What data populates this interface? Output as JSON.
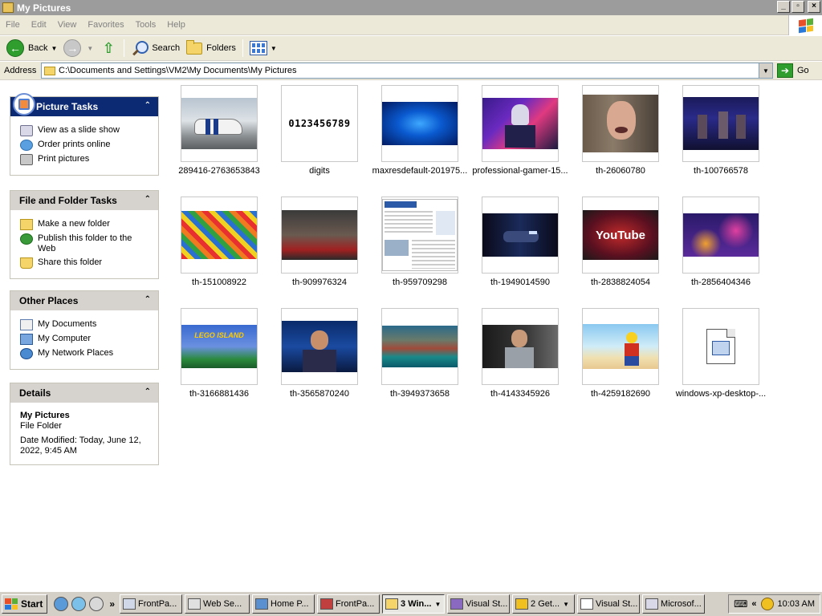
{
  "window": {
    "title": "My Pictures"
  },
  "menu": [
    "File",
    "Edit",
    "View",
    "Favorites",
    "Tools",
    "Help"
  ],
  "toolbar": {
    "back": "Back",
    "search": "Search",
    "folders": "Folders"
  },
  "address": {
    "label": "Address",
    "path": "C:\\Documents and Settings\\VM2\\My Documents\\My Pictures",
    "go": "Go"
  },
  "panels": {
    "picture_tasks": {
      "title": "Picture Tasks",
      "items": [
        "View as a slide show",
        "Order prints online",
        "Print pictures"
      ]
    },
    "file_folder_tasks": {
      "title": "File and Folder Tasks",
      "items": [
        "Make a new folder",
        "Publish this folder to the Web",
        "Share this folder"
      ]
    },
    "other_places": {
      "title": "Other Places",
      "items": [
        "My Documents",
        "My Computer",
        "My Network Places"
      ]
    },
    "details": {
      "title": "Details",
      "name": "My Pictures",
      "type": "File Folder",
      "modified": "Date Modified: Today, June 12, 2022, 9:45 AM"
    }
  },
  "files": [
    {
      "name": "289416-2763653843",
      "thumb": "car"
    },
    {
      "name": "digits",
      "thumb": "digits",
      "text": "0123456789"
    },
    {
      "name": "maxresdefault-201975...",
      "thumb": "blue-particles"
    },
    {
      "name": "professional-gamer-15...",
      "thumb": "gamer-stage"
    },
    {
      "name": "th-26060780",
      "thumb": "face"
    },
    {
      "name": "th-100766578",
      "thumb": "band"
    },
    {
      "name": "th-151008922",
      "thumb": "lego-bricks"
    },
    {
      "name": "th-909976324",
      "thumb": "gaming-cafe"
    },
    {
      "name": "th-959709298",
      "thumb": "webpage"
    },
    {
      "name": "th-1949014590",
      "thumb": "dark-car"
    },
    {
      "name": "th-2838824054",
      "thumb": "youtube",
      "text": "YouTube"
    },
    {
      "name": "th-2856404346",
      "thumb": "purple-bokeh"
    },
    {
      "name": "th-3166881436",
      "thumb": "lego-island",
      "text": "LEGO ISLAND"
    },
    {
      "name": "th-3565870240",
      "thumb": "streamer"
    },
    {
      "name": "th-3949373658",
      "thumb": "lake"
    },
    {
      "name": "th-4143345926",
      "thumb": "headset-guy"
    },
    {
      "name": "th-4259182690",
      "thumb": "lego-figure"
    },
    {
      "name": "windows-xp-desktop-...",
      "thumb": "document-icon"
    }
  ],
  "taskbar": {
    "start": "Start",
    "tasks": [
      {
        "label": "FrontPa...",
        "active": false,
        "dd": false
      },
      {
        "label": "Web Se...",
        "active": false,
        "dd": false
      },
      {
        "label": "Home P...",
        "active": false,
        "dd": false
      },
      {
        "label": "FrontPa...",
        "active": false,
        "dd": false
      },
      {
        "label": "3 Win...",
        "active": true,
        "dd": true
      },
      {
        "label": "Visual St...",
        "active": false,
        "dd": false
      },
      {
        "label": "2 Get...",
        "active": false,
        "dd": true
      },
      {
        "label": "Visual St...",
        "active": false,
        "dd": false
      },
      {
        "label": "Microsof...",
        "active": false,
        "dd": false
      }
    ],
    "clock": "10:03 AM"
  },
  "colors": {
    "panel_header_dark": "#0c2a73",
    "panel_header": "#d6d3ce",
    "title_bar": "#9c9c9c"
  }
}
